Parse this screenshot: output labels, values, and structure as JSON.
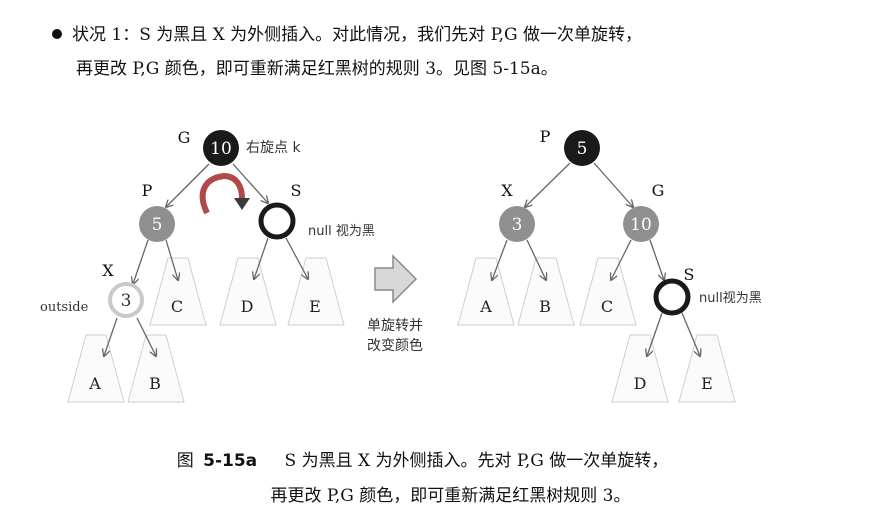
{
  "paragraph": {
    "line1": "状况 1：S 为黑且 X 为外侧插入。对此情况，我们先对 P,G 做一次单旋转，",
    "line2": "再更改 P,G 颜色，即可重新满足红黑树的规则 3。见图 5-15a。"
  },
  "left_tree": {
    "nodes": {
      "g": {
        "label": "G",
        "value": "10",
        "color": "black"
      },
      "p": {
        "label": "P",
        "value": "5",
        "color": "red"
      },
      "x": {
        "label": "X",
        "value": "3",
        "color": "red"
      },
      "s": {
        "label": "S",
        "value": "",
        "color": "black"
      }
    },
    "rotate_note": "右旋点 k",
    "null_note": "null 视为黑",
    "outside_note": "outside",
    "subtrees": [
      "C",
      "D",
      "E",
      "A",
      "B"
    ]
  },
  "transition_label": [
    "单旋转并",
    "改变颜色"
  ],
  "right_tree": {
    "nodes": {
      "p": {
        "label": "P",
        "value": "5",
        "color": "black"
      },
      "x": {
        "label": "X",
        "value": "3",
        "color": "red"
      },
      "g": {
        "label": "G",
        "value": "10",
        "color": "red"
      },
      "s": {
        "label": "S",
        "value": "",
        "color": "black"
      }
    },
    "null_note": "null视为黑",
    "subtrees": [
      "A",
      "B",
      "C",
      "D",
      "E"
    ]
  },
  "caption": {
    "figure_prefix": "图",
    "figure_number": "5-15a",
    "line1_text": "S 为黑且 X 为外侧插入。先对 P,G 做一次单旋转，",
    "line2": "再更改 P,G 颜色，即可重新满足红黑树规则 3。"
  },
  "colors": {
    "black_node": "#1a1a1a",
    "red_node": "#8f8f8f",
    "x_ring": "#c9c9c9",
    "arrow_red": "#b04a4a"
  }
}
